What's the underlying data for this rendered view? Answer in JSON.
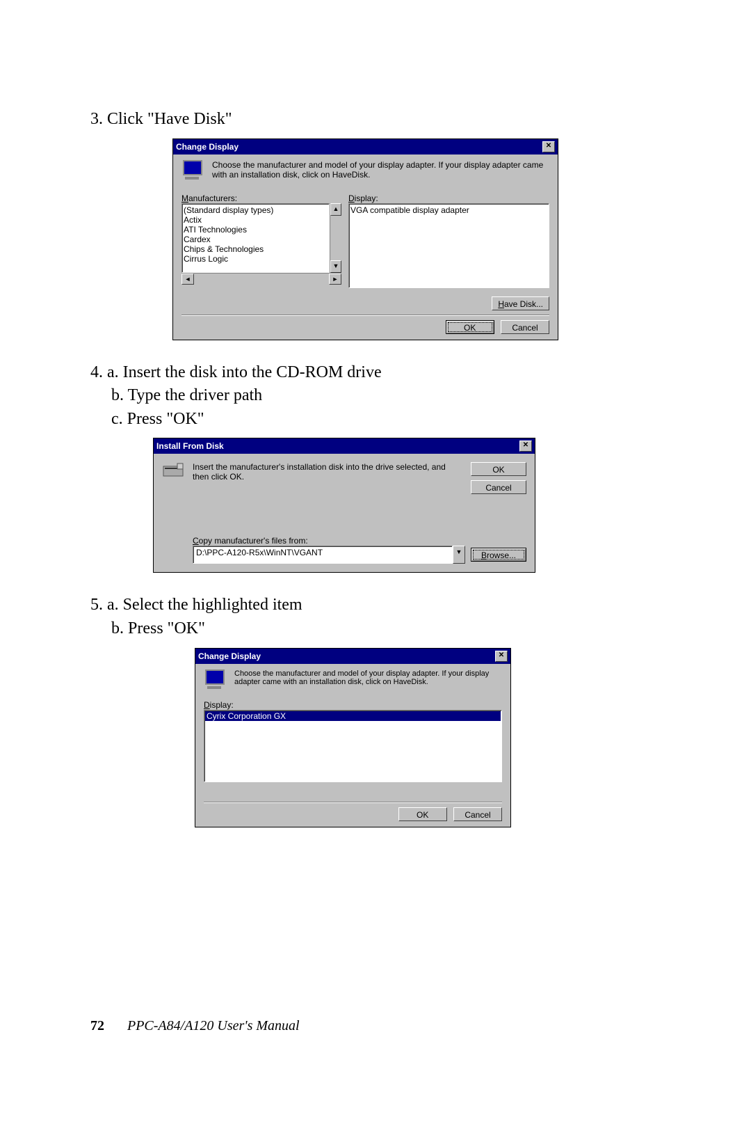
{
  "steps": {
    "s3": "3. Click  \"Have Disk\"",
    "s4a": "4. a. Insert the disk into the CD-ROM drive",
    "s4b": "b. Type the driver path",
    "s4c": "c. Press \"OK\"",
    "s5a": "5. a. Select the highlighted item",
    "s5b": "b. Press \"OK\""
  },
  "dialog1": {
    "title": "Change Display",
    "desc": "Choose the manufacturer and model of your display adapter.  If your display adapter came with an installation disk, click on HaveDisk.",
    "manufacturers_label": "Manufacturers:",
    "display_label": "Display:",
    "manufacturers": [
      "(Standard display types)",
      "Actix",
      "ATI Technologies",
      "Cardex",
      "Chips & Technologies",
      "Cirrus Logic"
    ],
    "displays": [
      "VGA compatible display adapter"
    ],
    "have_disk_btn": "Have Disk...",
    "ok_btn": "OK",
    "cancel_btn": "Cancel"
  },
  "dialog2": {
    "title": "Install From Disk",
    "desc": "Insert the manufacturer's installation disk into the drive selected, and then click OK.",
    "copy_label": "Copy manufacturer's files from:",
    "path": "D:\\PPC-A120-R5x\\WinNT\\VGANT",
    "ok_btn": "OK",
    "cancel_btn": "Cancel",
    "browse_btn": "Browse..."
  },
  "dialog3": {
    "title": "Change Display",
    "desc": "Choose the manufacturer and model of your display adapter.  If your display adapter came with an installation disk, click on HaveDisk.",
    "display_label": "Display:",
    "displays": [
      "Cyrix Corporation GX"
    ],
    "ok_btn": "OK",
    "cancel_btn": "Cancel"
  },
  "footer": {
    "page": "72",
    "title": "PPC-A84/A120   User's Manual"
  }
}
